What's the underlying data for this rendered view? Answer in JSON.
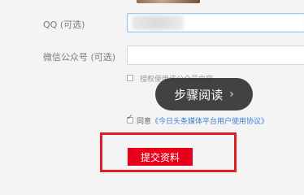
{
  "form": {
    "qq_label": "QQ (可选)",
    "wechat_label": "微信公众号 (可选)",
    "authorize_text": "授权使用该公众号内容",
    "agree_text": "同意",
    "agreement_link": "《今日头条媒体平台用户使用协议》",
    "submit_label": "提交资料"
  },
  "overlay": {
    "tip_label": "步骤阅读",
    "tip_arrow": "›"
  },
  "colors": {
    "submit": "#e8001a",
    "highlight": "#e11c24",
    "link": "#3b7fd1"
  }
}
